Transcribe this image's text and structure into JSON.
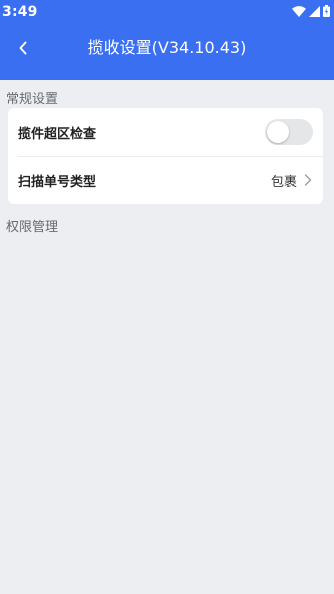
{
  "status_bar": {
    "time": "3:49",
    "icons": [
      "wifi-icon",
      "signal-icon",
      "battery-icon"
    ]
  },
  "header": {
    "back_icon": "back-arrow-icon",
    "title": "揽收设置(V34.10.43)"
  },
  "sections": {
    "general": {
      "title": "常规设置",
      "rows": [
        {
          "label": "揽件超区检查",
          "control": "toggle",
          "toggle_on": false
        },
        {
          "label": "扫描单号类型",
          "value": "包裹",
          "icon": "chevron-right-icon"
        }
      ]
    },
    "permissions": {
      "title": "权限管理"
    }
  },
  "colors": {
    "header_bg": "#3a6ff2",
    "page_bg": "#eceef1",
    "card_bg": "#ffffff"
  }
}
